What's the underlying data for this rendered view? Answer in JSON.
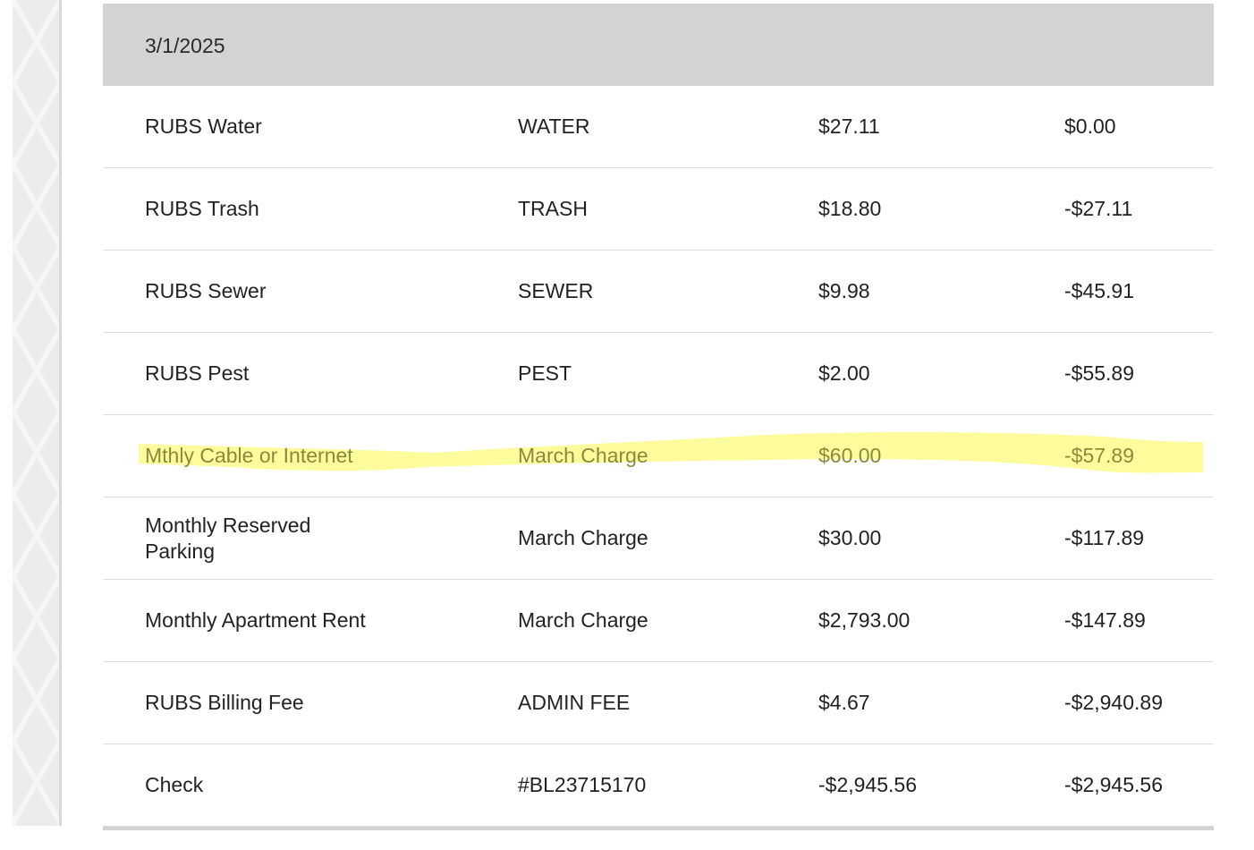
{
  "ledger": {
    "date": "3/1/2025",
    "rows": [
      {
        "description": "RUBS Water",
        "type": "WATER",
        "amount": "$27.11",
        "balance": "$0.00"
      },
      {
        "description": "RUBS Trash",
        "type": "TRASH",
        "amount": "$18.80",
        "balance": "-$27.11"
      },
      {
        "description": "RUBS Sewer",
        "type": "SEWER",
        "amount": "$9.98",
        "balance": "-$45.91"
      },
      {
        "description": "RUBS Pest",
        "type": "PEST",
        "amount": "$2.00",
        "balance": "-$55.89"
      },
      {
        "description": "Mthly Cable or Internet",
        "type": "March Charge",
        "amount": "$60.00",
        "balance": "-$57.89"
      },
      {
        "description": "Monthly Reserved Parking",
        "type": "March Charge",
        "amount": "$30.00",
        "balance": "-$117.89"
      },
      {
        "description": "Monthly Apartment Rent",
        "type": "March Charge",
        "amount": "$2,793.00",
        "balance": "-$147.89"
      },
      {
        "description": "RUBS Billing Fee",
        "type": "ADMIN FEE",
        "amount": "$4.67",
        "balance": "-$2,940.89"
      },
      {
        "description": "Check",
        "type": "#BL23715170",
        "amount": "-$2,945.56",
        "balance": "-$2,945.56"
      }
    ]
  },
  "colors": {
    "header_bg": "#d3d3d3",
    "highlighter": "#fbfb8c"
  }
}
